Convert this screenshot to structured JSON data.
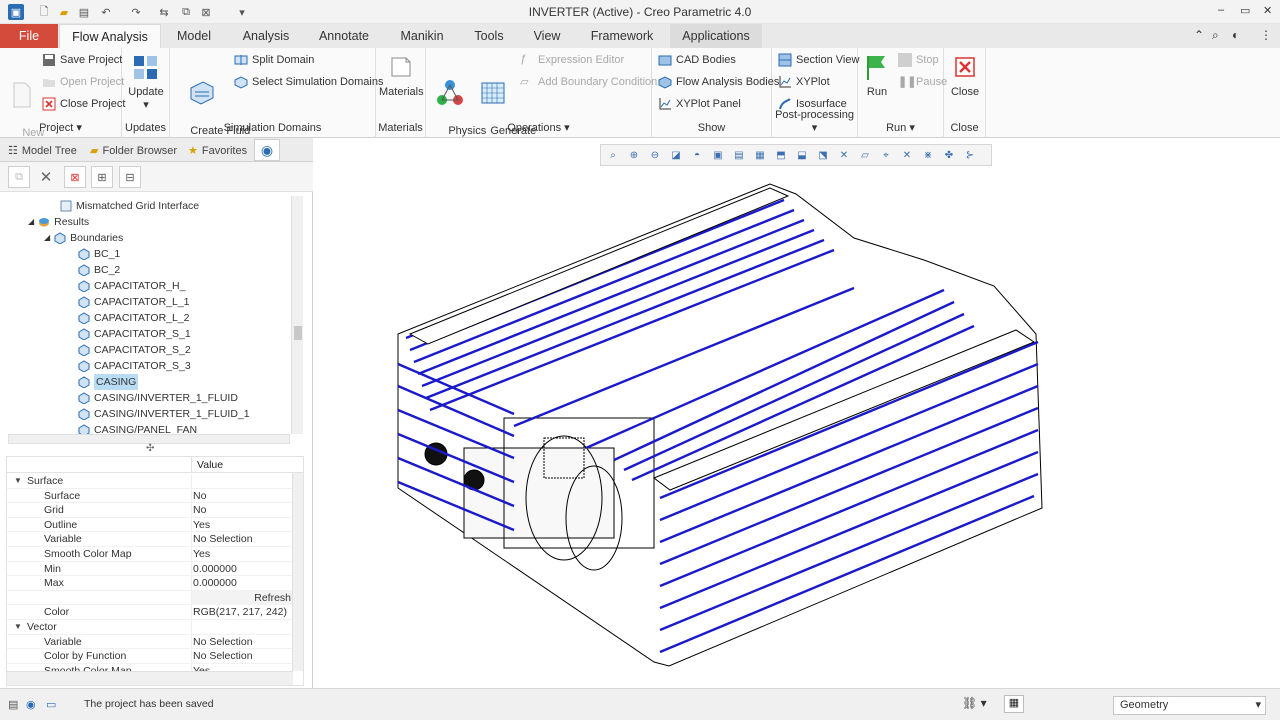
{
  "window": {
    "title": "INVERTER (Active) - Creo Parametric 4.0"
  },
  "tabs": [
    "File",
    "Flow Analysis",
    "Model",
    "Analysis",
    "Annotate",
    "Manikin",
    "Tools",
    "View",
    "Framework",
    "Applications"
  ],
  "ribbon": {
    "project": {
      "label": "Project",
      "new": "New\nProject",
      "save": "Save Project",
      "open": "Open Project",
      "close": "Close Project"
    },
    "updates": {
      "label": "Updates",
      "update": "Update"
    },
    "simdomains": {
      "label": "Simulation Domains",
      "create": "Create Fluid\nDomain",
      "split": "Split Domain",
      "select": "Select Simulation Domains"
    },
    "materials": {
      "label": "Materials",
      "materials": "Materials"
    },
    "operations": {
      "label": "Operations",
      "physics": "Physics\nModule",
      "mesh": "Generate\nMesh",
      "expr": "Expression Editor",
      "abc": "Add Boundary Condition"
    },
    "show": {
      "label": "Show",
      "cad": "CAD Bodies",
      "fab": "Flow Analysis Bodies",
      "xyplot_panel": "XYPlot Panel"
    },
    "post": {
      "label": "Post-processing",
      "section": "Section View",
      "xyplot": "XYPlot",
      "iso": "Isosurface"
    },
    "run": {
      "label": "Run",
      "run": "Run",
      "stop": "Stop",
      "pause": "Pause"
    },
    "close": {
      "label": "Close",
      "close": "Close"
    }
  },
  "panel": {
    "tabs": {
      "model_tree": "Model Tree",
      "folder_browser": "Folder Browser",
      "favorites": "Favorites"
    },
    "tree": [
      {
        "label": "Mismatched Grid Interface",
        "level": 3
      },
      {
        "label": "Results",
        "level": 1
      },
      {
        "label": "Boundaries",
        "level": 2
      },
      {
        "label": "BC_1",
        "level": 4
      },
      {
        "label": "BC_2",
        "level": 4
      },
      {
        "label": "CAPACITATOR_H_",
        "level": 4
      },
      {
        "label": "CAPACITATOR_L_1",
        "level": 4
      },
      {
        "label": "CAPACITATOR_L_2",
        "level": 4
      },
      {
        "label": "CAPACITATOR_S_1",
        "level": 4
      },
      {
        "label": "CAPACITATOR_S_2",
        "level": 4
      },
      {
        "label": "CAPACITATOR_S_3",
        "level": 4
      },
      {
        "label": "CASING",
        "level": 4,
        "selected": true
      },
      {
        "label": "CASING/INVERTER_1_FLUID",
        "level": 4
      },
      {
        "label": "CASING/INVERTER_1_FLUID_1",
        "level": 4
      },
      {
        "label": "CASING/PANEL_FAN",
        "level": 4
      }
    ],
    "props": {
      "value_header": "Value",
      "refresh": "Refresh",
      "rows": [
        {
          "k": "Surface",
          "v": "",
          "cat": true
        },
        {
          "k": "Surface",
          "v": "No"
        },
        {
          "k": "Grid",
          "v": "No"
        },
        {
          "k": "Outline",
          "v": "Yes"
        },
        {
          "k": "Variable",
          "v": "No Selection"
        },
        {
          "k": "Smooth Color Map",
          "v": "Yes"
        },
        {
          "k": "Min",
          "v": "0.000000"
        },
        {
          "k": "Max",
          "v": "0.000000"
        },
        {
          "k": "",
          "v": ""
        },
        {
          "k": "Color",
          "v": "RGB(217, 217, 242)"
        },
        {
          "k": "Vector",
          "v": "",
          "cat": true
        },
        {
          "k": "Variable",
          "v": "No Selection"
        },
        {
          "k": "Color by Function",
          "v": "No Selection"
        },
        {
          "k": "Smooth Color Map",
          "v": "Yes"
        }
      ]
    }
  },
  "status": {
    "message": "The project has been saved",
    "filter": "Geometry"
  }
}
